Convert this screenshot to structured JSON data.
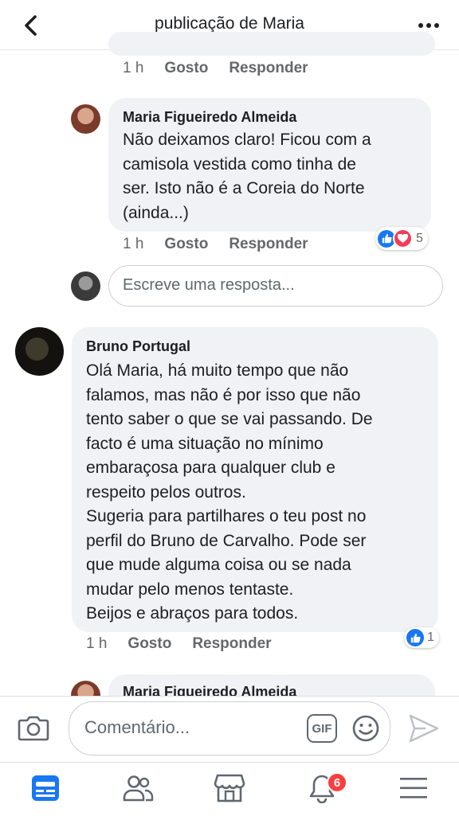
{
  "header": {
    "title": "publicação de Maria",
    "back_icon": "chevron-left-icon",
    "more_icon": "more-dots-icon"
  },
  "comments": [
    {
      "meta": {
        "time": "1 h",
        "like": "Gosto",
        "reply": "Responder"
      }
    },
    {
      "author": "Maria Figueiredo Almeida",
      "text": "Não deixamos claro! Ficou com a\ncamisola vestida como tinha de\nser. Isto não é a Coreia do Norte\n(ainda...)",
      "meta": {
        "time": "1 h",
        "like": "Gosto",
        "reply": "Responder"
      },
      "reactions": {
        "icons": [
          "like",
          "love"
        ],
        "count": "5"
      }
    },
    {
      "author": "Bruno Portugal",
      "text": "Olá Maria, há muito tempo que não\nfalamos, mas não é por isso que não\ntento saber o que se vai passando. De\nfacto é uma situação no mínimo\nembaraçosa para qualquer club e\nrespeito pelos outros.\nSugeria para partilhares o teu post no\nperfil do Bruno de Carvalho. Pode ser\nque mude alguma coisa ou se nada\nmudar pelo menos tentaste.\nBeijos e abraços para todos.",
      "meta": {
        "time": "1 h",
        "like": "Gosto",
        "reply": "Responder"
      },
      "reactions": {
        "icons": [
          "like"
        ],
        "count": "1"
      }
    },
    {
      "author": "Maria Figueiredo Almeida"
    }
  ],
  "reply_input": {
    "placeholder": "Escreve uma resposta..."
  },
  "comment_input": {
    "placeholder": "Comentário...",
    "gif_label": "GIF"
  },
  "tabbar": {
    "items": [
      "news-feed-icon",
      "friends-icon",
      "marketplace-icon",
      "notifications-icon",
      "menu-icon"
    ],
    "notifications_badge": "6"
  },
  "colors": {
    "accent": "#1877f2",
    "bubble": "#f0f2f5",
    "badge": "#fa3e3e",
    "love": "#f33e58"
  }
}
